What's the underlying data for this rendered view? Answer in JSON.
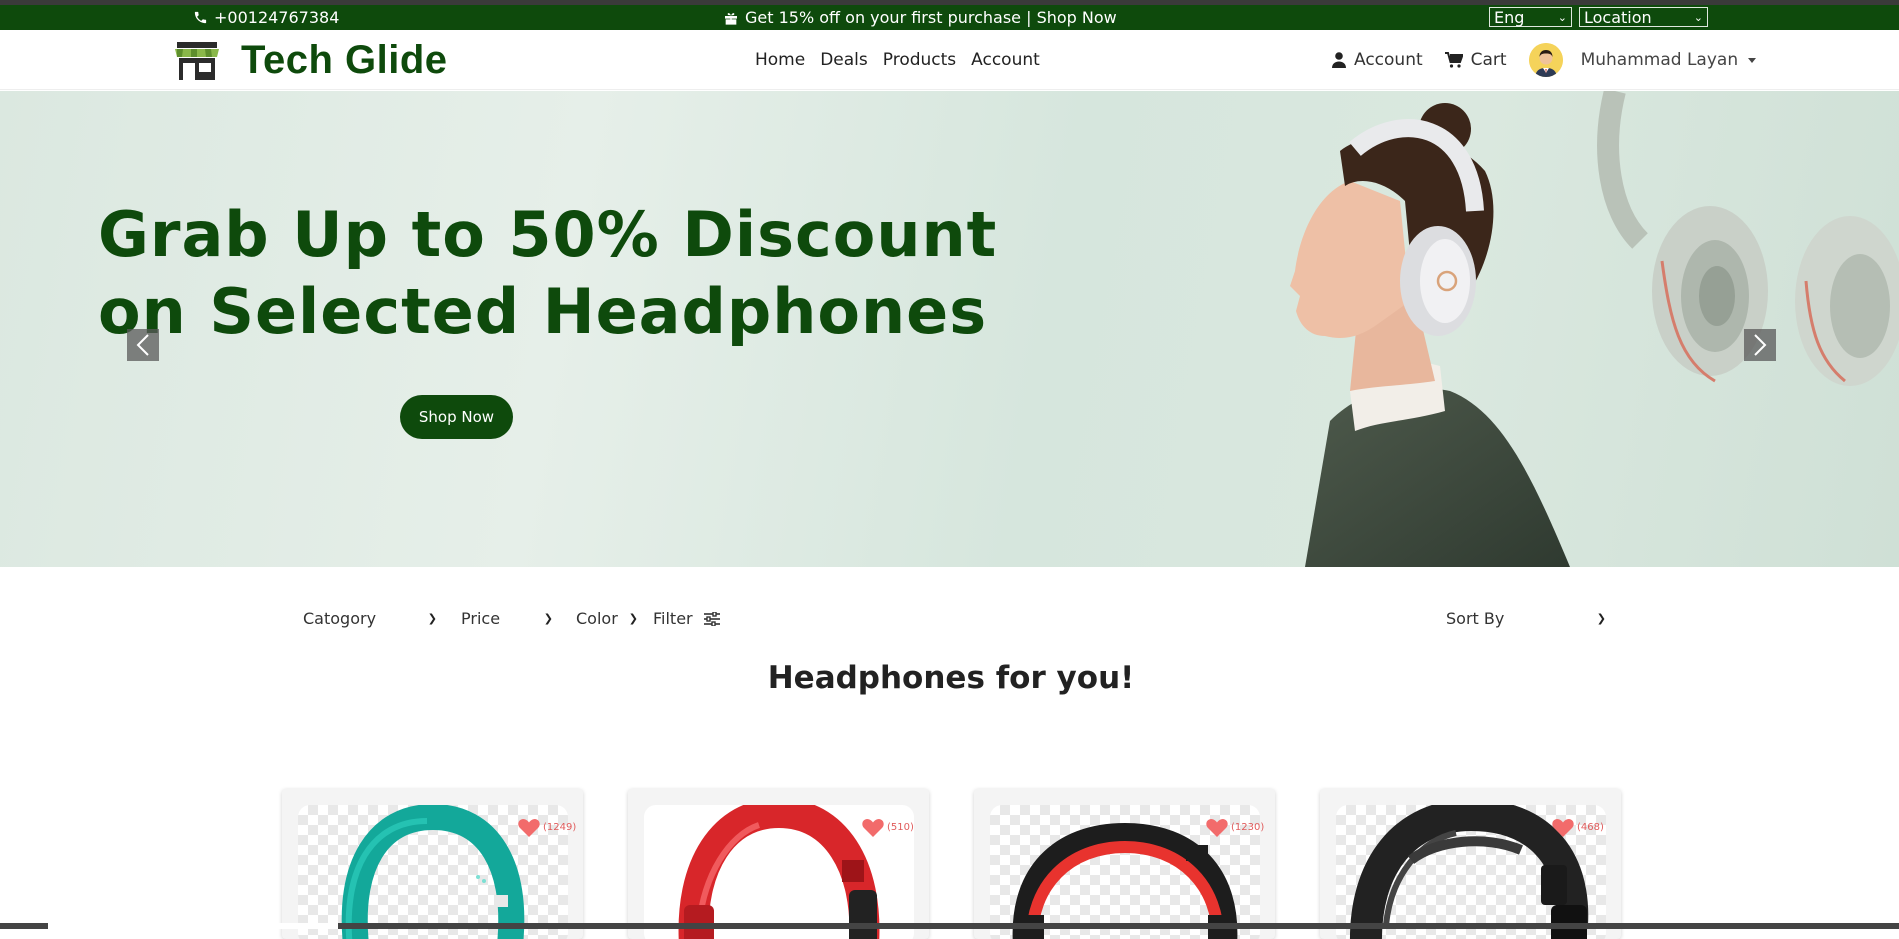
{
  "promo_bar": {
    "phone": "+00124767384",
    "offer": "Get 15% off on your first purchase | Shop Now",
    "language": "Eng",
    "location": "Location"
  },
  "header": {
    "brand": "Tech Glide",
    "nav": [
      "Home",
      "Deals",
      "Products",
      "Account"
    ],
    "account_label": "Account",
    "cart_label": "Cart",
    "user_name": "Muhammad Layan"
  },
  "hero": {
    "title_line1": "Grab Up to 50% Discount",
    "title_line2": "on Selected Headphones",
    "cta": "Shop Now"
  },
  "filters": {
    "category": "Catogory",
    "price": "Price",
    "color": "Color",
    "filter": "Filter",
    "sort": "Sort By"
  },
  "section_title": "Headphones for you!",
  "products": [
    {
      "reviews": "(1249)",
      "color": "#13a89a"
    },
    {
      "reviews": "(510)",
      "color": "#d8262a"
    },
    {
      "reviews": "(1230)",
      "color": "#e8332e"
    },
    {
      "reviews": "(468)",
      "color": "#222222"
    }
  ],
  "colors": {
    "brand_green": "#0e4a0c",
    "heart": "#f26b6b"
  }
}
